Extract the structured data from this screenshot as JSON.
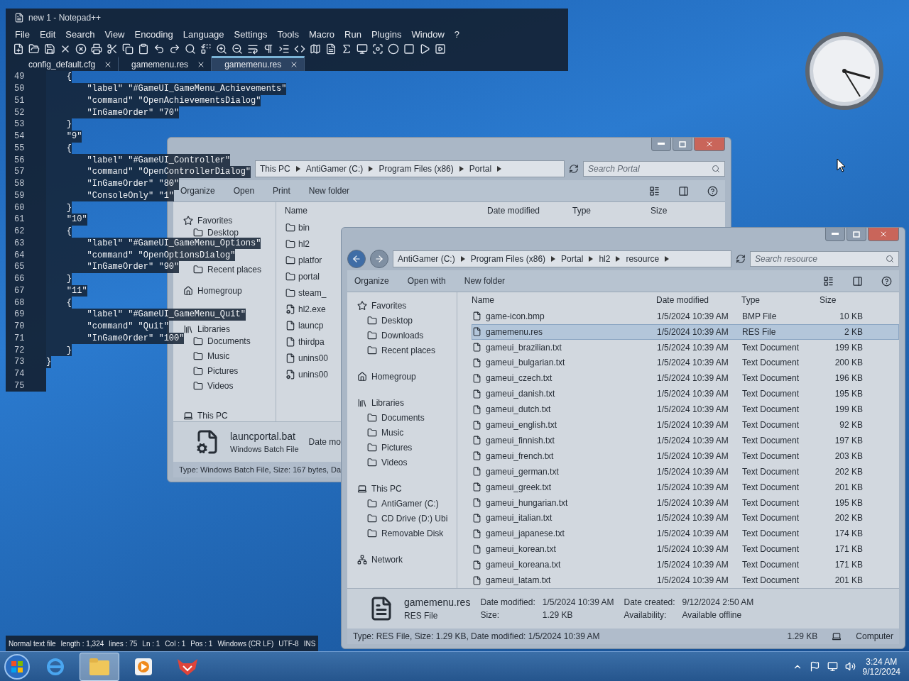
{
  "notepad": {
    "title": "new 1 - Notepad++",
    "menu": [
      "File",
      "Edit",
      "Search",
      "View",
      "Encoding",
      "Language",
      "Settings",
      "Tools",
      "Macro",
      "Run",
      "Plugins",
      "Window",
      "?"
    ],
    "tabs": [
      {
        "label": "config_default.cfg",
        "selected": false
      },
      {
        "label": "gamemenu.res",
        "selected": false
      },
      {
        "label": "gamemenu.res",
        "selected": true
      }
    ],
    "lines": [
      {
        "number": "49",
        "code": "    {"
      },
      {
        "number": "50",
        "code": "        \"label\" \"#GameUI_GameMenu_Achievements\""
      },
      {
        "number": "51",
        "code": "        \"command\" \"OpenAchievementsDialog\""
      },
      {
        "number": "52",
        "code": "        \"InGameOrder\" \"70\""
      },
      {
        "number": "53",
        "code": "    }"
      },
      {
        "number": "54",
        "code": "    \"9\""
      },
      {
        "number": "55",
        "code": "    {"
      },
      {
        "number": "56",
        "code": "        \"label\" \"#GameUI_Controller\""
      },
      {
        "number": "57",
        "code": "        \"command\" \"OpenControllerDialog\""
      },
      {
        "number": "58",
        "code": "        \"InGameOrder\" \"80\""
      },
      {
        "number": "59",
        "code": "        \"ConsoleOnly\" \"1\""
      },
      {
        "number": "60",
        "code": "    }"
      },
      {
        "number": "61",
        "code": "    \"10\""
      },
      {
        "number": "62",
        "code": "    {"
      },
      {
        "number": "63",
        "code": "        \"label\" \"#GameUI_GameMenu_Options\""
      },
      {
        "number": "64",
        "code": "        \"command\" \"OpenOptionsDialog\""
      },
      {
        "number": "65",
        "code": "        \"InGameOrder\" \"90\""
      },
      {
        "number": "66",
        "code": "    }"
      },
      {
        "number": "67",
        "code": "    \"11\""
      },
      {
        "number": "68",
        "code": "    {"
      },
      {
        "number": "69",
        "code": "        \"label\" \"#GameUI_GameMenu_Quit\""
      },
      {
        "number": "70",
        "code": "        \"command\" \"Quit\""
      },
      {
        "number": "71",
        "code": "        \"InGameOrder\" \"100\""
      },
      {
        "number": "72",
        "code": "    }"
      },
      {
        "number": "73",
        "code": "}"
      },
      {
        "number": "74"
      },
      {
        "number": "75"
      }
    ],
    "status": [
      "Normal text file",
      "length : 1,324",
      "lines : 75",
      "Ln : 1",
      "Col : 1",
      "Pos : 1",
      "Windows (CR LF)",
      "UTF-8",
      "INS"
    ]
  },
  "explorer_back": {
    "path": [
      "This PC",
      "AntiGamer (C:)",
      "Program Files (x86)",
      "Portal"
    ],
    "search_placeholder": "Search Portal",
    "toolbar": [
      "Organize",
      "Open",
      "Print",
      "New folder"
    ],
    "nav": [
      {
        "label": "Favorites",
        "children": [
          {
            "label": "Desktop"
          },
          {
            "label": "Recent places"
          }
        ]
      },
      {
        "label": "Homegroup"
      },
      {
        "label": "Libraries",
        "children": [
          {
            "label": "Documents"
          },
          {
            "label": "Music"
          },
          {
            "label": "Pictures"
          },
          {
            "label": "Videos"
          }
        ]
      },
      {
        "label": "This PC"
      }
    ],
    "columns": [
      "Name",
      "Date modified",
      "Type",
      "Size"
    ],
    "files": [
      {
        "name": "bin",
        "kind": "folder"
      },
      {
        "name": "hl2",
        "kind": "folder"
      },
      {
        "name": "platfor",
        "kind": "folder"
      },
      {
        "name": "portal",
        "kind": "folder"
      },
      {
        "name": "steam_",
        "kind": "folder"
      },
      {
        "name": "hl2.exe",
        "kind": "app"
      },
      {
        "name": "launcp",
        "kind": "file"
      },
      {
        "name": "thirdpa",
        "kind": "file"
      },
      {
        "name": "unins00",
        "kind": "file"
      },
      {
        "name": "unins00",
        "kind": "app"
      }
    ],
    "details": {
      "name": "launcportal.bat",
      "label": "Date mo",
      "type": "Windows Batch File"
    },
    "status": "Type: Windows Batch File, Size: 167 bytes, Da"
  },
  "explorer_front": {
    "path": [
      "AntiGamer (C:)",
      "Program Files (x86)",
      "Portal",
      "hl2",
      "resource"
    ],
    "search_placeholder": "Search resource",
    "toolbar": [
      "Organize",
      "Open with",
      "New folder"
    ],
    "nav": [
      {
        "label": "Favorites",
        "children": [
          {
            "label": "Desktop"
          },
          {
            "label": "Downloads"
          },
          {
            "label": "Recent places"
          }
        ]
      },
      {
        "label": "Homegroup"
      },
      {
        "label": "Libraries",
        "children": [
          {
            "label": "Documents"
          },
          {
            "label": "Music"
          },
          {
            "label": "Pictures"
          },
          {
            "label": "Videos"
          }
        ]
      },
      {
        "label": "This PC",
        "children": [
          {
            "label": "AntiGamer (C:)"
          },
          {
            "label": "CD Drive (D:) Ubi"
          },
          {
            "label": "Removable Disk"
          }
        ]
      },
      {
        "label": "Network"
      }
    ],
    "columns": [
      "Name",
      "Date modified",
      "Type",
      "Size"
    ],
    "rows": [
      {
        "name": "game-icon.bmp",
        "date": "1/5/2024 10:39 AM",
        "type": "BMP File",
        "size": "10 KB",
        "selected": false
      },
      {
        "name": "gamemenu.res",
        "date": "1/5/2024 10:39 AM",
        "type": "RES File",
        "size": "2 KB",
        "selected": true
      },
      {
        "name": "gameui_brazilian.txt",
        "date": "1/5/2024 10:39 AM",
        "type": "Text Document",
        "size": "199 KB",
        "selected": false
      },
      {
        "name": "gameui_bulgarian.txt",
        "date": "1/5/2024 10:39 AM",
        "type": "Text Document",
        "size": "200 KB",
        "selected": false
      },
      {
        "name": "gameui_czech.txt",
        "date": "1/5/2024 10:39 AM",
        "type": "Text Document",
        "size": "196 KB",
        "selected": false
      },
      {
        "name": "gameui_danish.txt",
        "date": "1/5/2024 10:39 AM",
        "type": "Text Document",
        "size": "195 KB",
        "selected": false
      },
      {
        "name": "gameui_dutch.txt",
        "date": "1/5/2024 10:39 AM",
        "type": "Text Document",
        "size": "199 KB",
        "selected": false
      },
      {
        "name": "gameui_english.txt",
        "date": "1/5/2024 10:39 AM",
        "type": "Text Document",
        "size": "92 KB",
        "selected": false
      },
      {
        "name": "gameui_finnish.txt",
        "date": "1/5/2024 10:39 AM",
        "type": "Text Document",
        "size": "197 KB",
        "selected": false
      },
      {
        "name": "gameui_french.txt",
        "date": "1/5/2024 10:39 AM",
        "type": "Text Document",
        "size": "203 KB",
        "selected": false
      },
      {
        "name": "gameui_german.txt",
        "date": "1/5/2024 10:39 AM",
        "type": "Text Document",
        "size": "202 KB",
        "selected": false
      },
      {
        "name": "gameui_greek.txt",
        "date": "1/5/2024 10:39 AM",
        "type": "Text Document",
        "size": "201 KB",
        "selected": false
      },
      {
        "name": "gameui_hungarian.txt",
        "date": "1/5/2024 10:39 AM",
        "type": "Text Document",
        "size": "195 KB",
        "selected": false
      },
      {
        "name": "gameui_italian.txt",
        "date": "1/5/2024 10:39 AM",
        "type": "Text Document",
        "size": "202 KB",
        "selected": false
      },
      {
        "name": "gameui_japanese.txt",
        "date": "1/5/2024 10:39 AM",
        "type": "Text Document",
        "size": "174 KB",
        "selected": false
      },
      {
        "name": "gameui_korean.txt",
        "date": "1/5/2024 10:39 AM",
        "type": "Text Document",
        "size": "171 KB",
        "selected": false
      },
      {
        "name": "gameui_koreana.txt",
        "date": "1/5/2024 10:39 AM",
        "type": "Text Document",
        "size": "171 KB",
        "selected": false
      },
      {
        "name": "gameui_latam.txt",
        "date": "1/5/2024 10:39 AM",
        "type": "Text Document",
        "size": "201 KB",
        "selected": false
      }
    ],
    "details": {
      "name": "gamemenu.res",
      "type": "RES File",
      "fields": [
        {
          "label": "Date modified:",
          "value": "1/5/2024 10:39 AM"
        },
        {
          "label": "Size:",
          "value": "1.29 KB"
        },
        {
          "label": "Date created:",
          "value": "9/12/2024 2:50 AM"
        },
        {
          "label": "Availability:",
          "value": "Available offline"
        }
      ]
    },
    "status": "Type: RES File, Size: 1.29 KB, Date modified: 1/5/2024 10:39 AM",
    "status_size": "1.29 KB",
    "status_zone": "Computer"
  },
  "taskbar": {
    "apps": [
      {
        "kind": "browser",
        "selected": false
      },
      {
        "kind": "folder",
        "selected": true
      },
      {
        "kind": "media",
        "selected": false
      },
      {
        "kind": "game",
        "selected": false
      }
    ],
    "time": "3:24 AM",
    "date": "9/12/2024"
  }
}
